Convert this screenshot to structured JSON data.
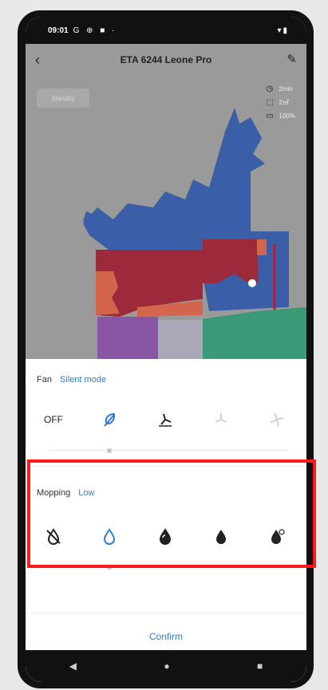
{
  "status_bar": {
    "time": "09:01",
    "icons_left": "G ⊕ ■ ·",
    "icons_right": "▾▮"
  },
  "header": {
    "back_icon": "chevron-left-icon",
    "title": "ETA 6244 Leone Pro",
    "edit_icon": "pencil-icon"
  },
  "map": {
    "status_badge": "Standby",
    "stats": [
      {
        "icon": "clock-icon",
        "value": "2min"
      },
      {
        "icon": "area-icon",
        "value": "2㎡"
      },
      {
        "icon": "battery-icon",
        "value": "100%"
      }
    ],
    "colors": {
      "background": "#9a9a9a",
      "blue": "#3b5ea8",
      "red": "#9c2a3a",
      "orange": "#d4654d",
      "purple": "#8a55a3",
      "green": "#3a9a77"
    }
  },
  "fan": {
    "label": "Fan",
    "value": "Silent mode",
    "off_label": "OFF",
    "options": [
      "off",
      "silent-icon",
      "standard-icon",
      "strong-icon",
      "max-icon"
    ],
    "selected_index": 1
  },
  "mopping": {
    "label": "Mopping",
    "value": "Low",
    "options": [
      "mop-off-icon",
      "mop-low-icon",
      "mop-medium-icon",
      "mop-high-icon",
      "mop-custom-icon"
    ],
    "selected_index": 1
  },
  "confirm_label": "Confirm",
  "accent_color": "#2f7bd9"
}
